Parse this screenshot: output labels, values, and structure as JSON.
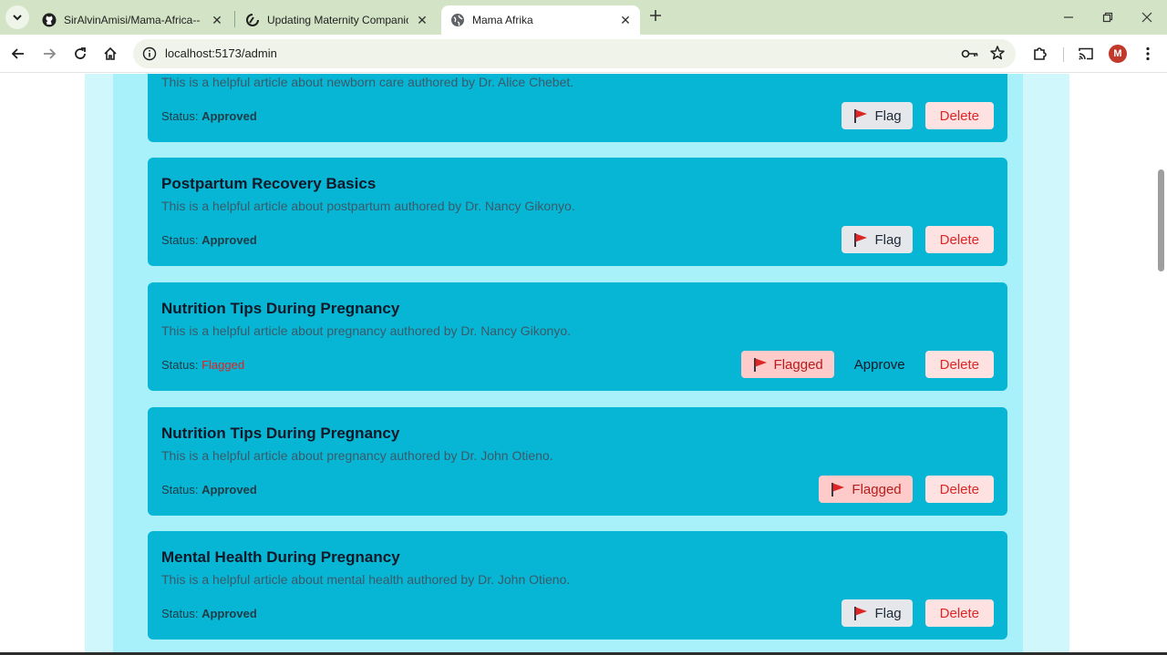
{
  "browser": {
    "tabs": [
      {
        "title": "SirAlvinAmisi/Mama-Africa---M",
        "icon": "github-icon",
        "active": false
      },
      {
        "title": "Updating Maternity Companion",
        "icon": "loading-icon",
        "active": false
      },
      {
        "title": "Mama Afrika",
        "icon": "globe-icon",
        "active": true
      }
    ],
    "url": "localhost:5173/admin",
    "profile_initial": "M"
  },
  "colors": {
    "card": "#06b6d4",
    "panel": "#a8f1fa",
    "band": "#cff7fc",
    "flagged_text": "#dc2626",
    "delete_bg": "#fee2e2"
  },
  "articles": [
    {
      "title": "",
      "description": "This is a helpful article about newborn care authored by Dr. Alice Chebet.",
      "status_label": "Status:",
      "status": "Approved",
      "flag_label": "Flag",
      "delete_label": "Delete"
    },
    {
      "title": "Postpartum Recovery Basics",
      "description": "This is a helpful article about postpartum authored by Dr. Nancy Gikonyo.",
      "status_label": "Status:",
      "status": "Approved",
      "flag_label": "Flag",
      "delete_label": "Delete"
    },
    {
      "title": "Nutrition Tips During Pregnancy",
      "description": "This is a helpful article about pregnancy authored by Dr. Nancy Gikonyo.",
      "status_label": "Status:",
      "status": "Flagged",
      "flag_label": "Flagged",
      "approve_label": "Approve",
      "delete_label": "Delete"
    },
    {
      "title": "Nutrition Tips During Pregnancy",
      "description": "This is a helpful article about pregnancy authored by Dr. John Otieno.",
      "status_label": "Status:",
      "status": "Approved",
      "flag_label": "Flagged",
      "delete_label": "Delete"
    },
    {
      "title": "Mental Health During Pregnancy",
      "description": "This is a helpful article about mental health authored by Dr. John Otieno.",
      "status_label": "Status:",
      "status": "Approved",
      "flag_label": "Flag",
      "delete_label": "Delete"
    }
  ]
}
